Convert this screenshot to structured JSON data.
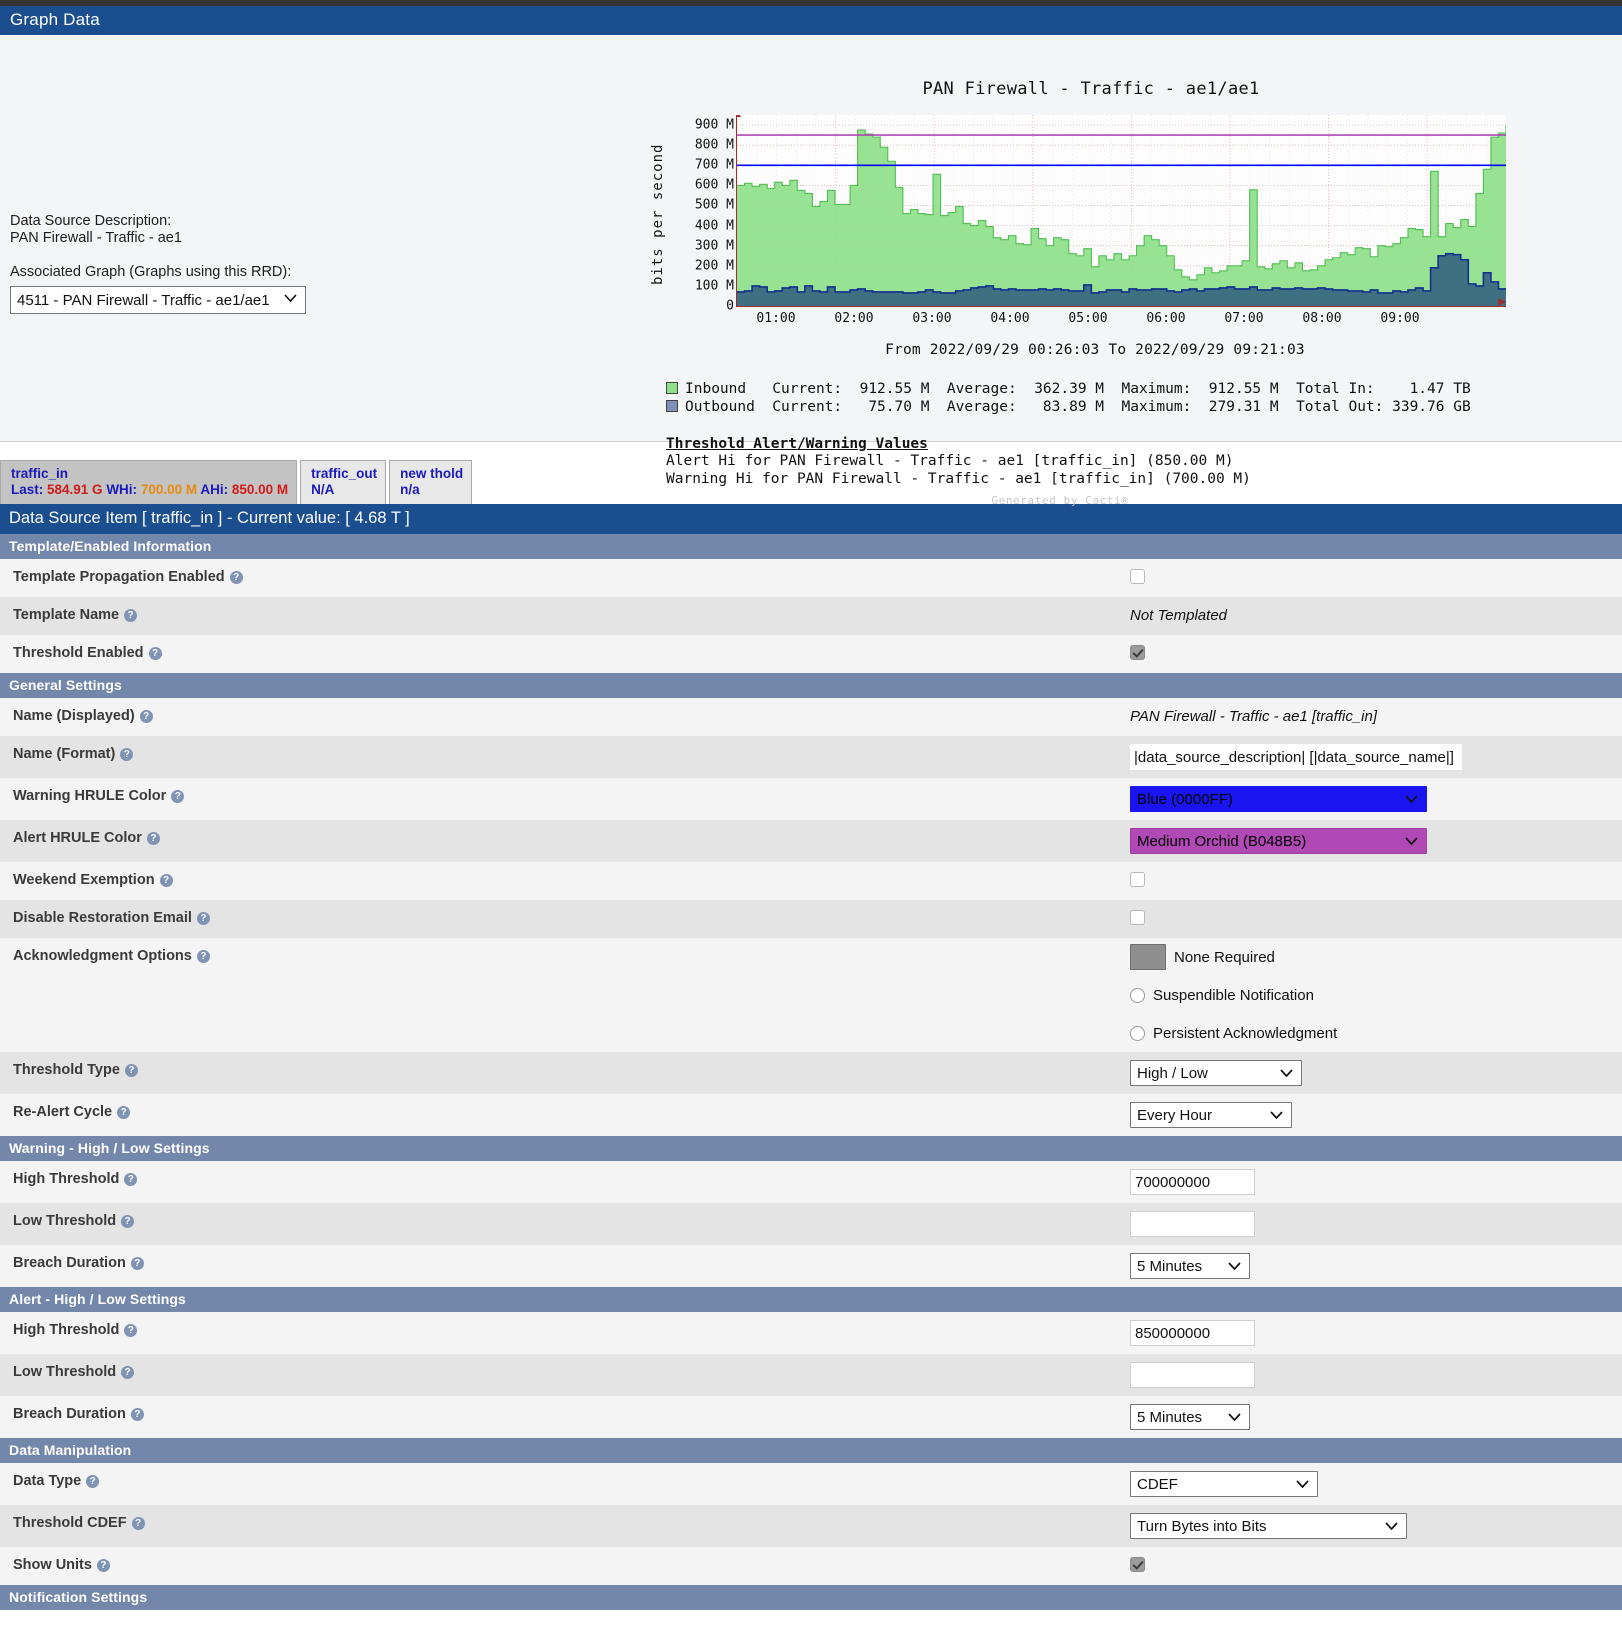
{
  "page": {
    "header_title": "Graph Data",
    "ds_item_title": "Data Source Item [ traffic_in ] - Current value: [ 4.68 T ]"
  },
  "left_panel": {
    "ds_desc_label": "Data Source Description:",
    "ds_desc_value": "PAN Firewall - Traffic - ae1",
    "assoc_label": "Associated Graph (Graphs using this RRD):",
    "assoc_selected": "4511 - PAN Firewall - Traffic - ae1/ae1"
  },
  "chart_data": {
    "type": "area",
    "title": "PAN Firewall - Traffic - ae1/ae1",
    "ylabel": "bits per second",
    "xlabel": "",
    "ylim": [
      0,
      950000000
    ],
    "ytick_labels": [
      "900 M",
      "800 M",
      "700 M",
      "600 M",
      "500 M",
      "400 M",
      "300 M",
      "200 M",
      "100 M",
      "0"
    ],
    "ytick_values": [
      900000000,
      800000000,
      700000000,
      600000000,
      500000000,
      400000000,
      300000000,
      200000000,
      100000000,
      0
    ],
    "xtick_labels": [
      "01:00",
      "02:00",
      "03:00",
      "04:00",
      "05:00",
      "06:00",
      "07:00",
      "08:00",
      "09:00"
    ],
    "grid": true,
    "timespan": "From 2022/09/29 00:26:03 To 2022/09/29 09:21:03",
    "legend_position": "below",
    "colors": {
      "inbound": "#8ee08a",
      "outbound": "#39697f",
      "outbound_line": "#12308f",
      "alert_hrule": "#b048b5",
      "warning_hrule": "#0000ff"
    },
    "hrules": [
      {
        "name": "Alert Hi",
        "value": 850000000,
        "color": "#b048b5"
      },
      {
        "name": "Warning Hi",
        "value": 700000000,
        "color": "#0000ff"
      }
    ],
    "series": [
      {
        "name": "Inbound",
        "color": "#8ee08a",
        "values": [
          600,
          610,
          595,
          605,
          585,
          615,
          600,
          625,
          575,
          560,
          495,
          520,
          575,
          505,
          505,
          600,
          875,
          855,
          840,
          790,
          720,
          590,
          460,
          480,
          460,
          455,
          655,
          450,
          465,
          495,
          410,
          400,
          425,
          395,
          340,
          330,
          350,
          310,
          305,
          385,
          335,
          300,
          340,
          330,
          260,
          250,
          285,
          195,
          250,
          230,
          260,
          230,
          250,
          300,
          350,
          330,
          300,
          250,
          180,
          145,
          130,
          155,
          190,
          165,
          175,
          200,
          200,
          225,
          578,
          195,
          185,
          210,
          225,
          190,
          215,
          175,
          180,
          200,
          230,
          240,
          265,
          255,
          290,
          285,
          245,
          300,
          295,
          310,
          340,
          385,
          380,
          345,
          670,
          345,
          410,
          390,
          430,
          395,
          560,
          680,
          840,
          860,
          900
        ]
      },
      {
        "name": "Outbound",
        "color": "#39697f",
        "values": [
          70,
          75,
          100,
          95,
          70,
          75,
          90,
          95,
          70,
          100,
          75,
          70,
          95,
          70,
          70,
          80,
          85,
          75,
          70,
          70,
          70,
          70,
          65,
          65,
          70,
          80,
          70,
          65,
          65,
          75,
          80,
          90,
          95,
          100,
          85,
          80,
          85,
          80,
          80,
          80,
          85,
          80,
          85,
          80,
          75,
          75,
          105,
          65,
          70,
          80,
          80,
          70,
          85,
          80,
          80,
          85,
          85,
          75,
          70,
          80,
          85,
          75,
          85,
          85,
          90,
          95,
          85,
          85,
          95,
          80,
          80,
          90,
          85,
          85,
          90,
          85,
          85,
          90,
          85,
          80,
          80,
          75,
          75,
          70,
          80,
          65,
          65,
          75,
          70,
          80,
          90,
          75,
          190,
          250,
          260,
          255,
          230,
          110,
          100,
          165,
          120,
          85,
          80
        ]
      }
    ],
    "legend": [
      {
        "name": "Inbound",
        "color": "#8ee08a",
        "current_label": "Current:",
        "current": "912.55 M",
        "average_label": "Average:",
        "average": "362.39 M",
        "maximum_label": "Maximum:",
        "maximum": "912.55 M",
        "total_label": "Total In:",
        "total": "1.47 TB"
      },
      {
        "name": "Outbound",
        "color": "#7b8fb8",
        "current_label": "Current:",
        "current": "75.70 M",
        "average_label": "Average:",
        "average": "83.89 M",
        "maximum_label": "Maximum:",
        "maximum": "279.31 M",
        "total_label": "Total Out:",
        "total": "339.76 GB"
      }
    ],
    "threshold_header": "Threshold Alert/Warning Values",
    "threshold_lines": [
      {
        "color": "#b048b5",
        "text": "Alert Hi for PAN Firewall - Traffic - ae1 [traffic_in] (850.00 M)"
      },
      {
        "color": "#0000ff",
        "text": "Warning Hi for PAN Firewall - Traffic - ae1 [traffic_in] (700.00 M)"
      }
    ],
    "watermark": "Generated by Cacti®"
  },
  "tabs": [
    {
      "name": "traffic_in",
      "active": true,
      "line2_parts": [
        {
          "text": "Last: ",
          "color": "blue"
        },
        {
          "text": "584.91 G ",
          "color": "red"
        },
        {
          "text": "WHi: ",
          "color": "blue"
        },
        {
          "text": "700.00 M ",
          "color": "orange"
        },
        {
          "text": "AHi: ",
          "color": "blue"
        },
        {
          "text": "850.00 M",
          "color": "red"
        }
      ]
    },
    {
      "name": "traffic_out",
      "active": false,
      "line2": "N/A"
    },
    {
      "name": "new thold",
      "active": false,
      "line2": "n/a"
    }
  ],
  "sections": [
    {
      "title": "Template/Enabled Information",
      "rows": [
        {
          "label": "Template Propagation Enabled",
          "type": "checkbox",
          "checked": false
        },
        {
          "label": "Template Name",
          "type": "italic",
          "value": "Not Templated"
        },
        {
          "label": "Threshold Enabled",
          "type": "checkbox",
          "checked": true
        }
      ]
    },
    {
      "title": "General Settings",
      "rows": [
        {
          "label": "Name (Displayed)",
          "type": "italic",
          "value": "PAN Firewall - Traffic - ae1 [traffic_in]"
        },
        {
          "label": "Name (Format)",
          "type": "text-plain",
          "value": "|data_source_description| [|data_source_name|]"
        },
        {
          "label": "Warning HRULE Color",
          "type": "select-color",
          "value": "Blue (0000FF)",
          "color_class": "blue",
          "width": "w297"
        },
        {
          "label": "Alert HRULE Color",
          "type": "select-color",
          "value": "Medium Orchid (B048B5)",
          "color_class": "orchid",
          "width": "w297"
        },
        {
          "label": "Weekend Exemption",
          "type": "checkbox",
          "checked": false
        },
        {
          "label": "Disable Restoration Email",
          "type": "checkbox",
          "checked": false
        },
        {
          "label": "Acknowledgment Options",
          "type": "radio",
          "options": [
            {
              "label": "None Required",
              "selected": true
            },
            {
              "label": "Suspendible Notification",
              "selected": false
            },
            {
              "label": "Persistent Acknowledgment",
              "selected": false
            }
          ]
        },
        {
          "label": "Threshold Type",
          "type": "select",
          "value": "High / Low",
          "width": "w172"
        },
        {
          "label": "Re-Alert Cycle",
          "type": "select",
          "value": "Every Hour",
          "width": "w162"
        }
      ]
    },
    {
      "title": "Warning - High / Low Settings",
      "rows": [
        {
          "label": "High Threshold",
          "type": "text",
          "value": "700000000"
        },
        {
          "label": "Low Threshold",
          "type": "text",
          "value": ""
        },
        {
          "label": "Breach Duration",
          "type": "select",
          "value": "5 Minutes",
          "width": "w120"
        }
      ]
    },
    {
      "title": "Alert - High / Low Settings",
      "rows": [
        {
          "label": "High Threshold",
          "type": "text",
          "value": "850000000"
        },
        {
          "label": "Low Threshold",
          "type": "text",
          "value": ""
        },
        {
          "label": "Breach Duration",
          "type": "select",
          "value": "5 Minutes",
          "width": "w120"
        }
      ]
    },
    {
      "title": "Data Manipulation",
      "rows": [
        {
          "label": "Data Type",
          "type": "select",
          "value": "CDEF",
          "width": "w188"
        },
        {
          "label": "Threshold CDEF",
          "type": "select",
          "value": "Turn Bytes into Bits",
          "width": "w277"
        },
        {
          "label": "Show Units",
          "type": "checkbox",
          "checked": true
        }
      ]
    },
    {
      "title": "Notification Settings",
      "rows": []
    }
  ]
}
